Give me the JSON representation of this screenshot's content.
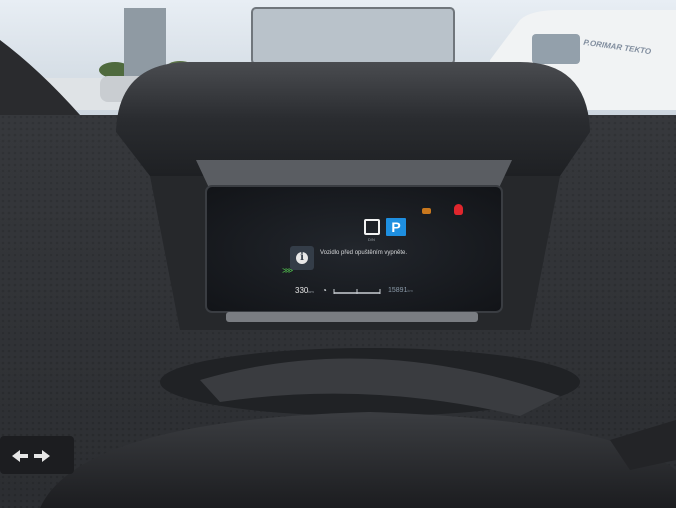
{
  "scene": {
    "description_colors": {
      "sky": "#d9e4ee",
      "dashboard": "#2f3134",
      "display_bg": "#1a1d22",
      "accent_blue": "#1e8fe0"
    }
  },
  "display": {
    "gear_selected": "P",
    "gear_caption": "D/N",
    "message": "Vozidlo před opuštěním vypněte.",
    "range_value": "330",
    "range_unit": "km",
    "odometer_value": "15891",
    "odometer_unit": "km",
    "icons": [
      "info-icon",
      "amber-warning-icon",
      "red-warning-icon",
      "green-indicator-icon",
      "eco-icon"
    ]
  },
  "background_lettering": {
    "van_text": "P.ORIMAR TEKTO"
  },
  "stalk": {
    "icon": "turn-signal-icon"
  }
}
